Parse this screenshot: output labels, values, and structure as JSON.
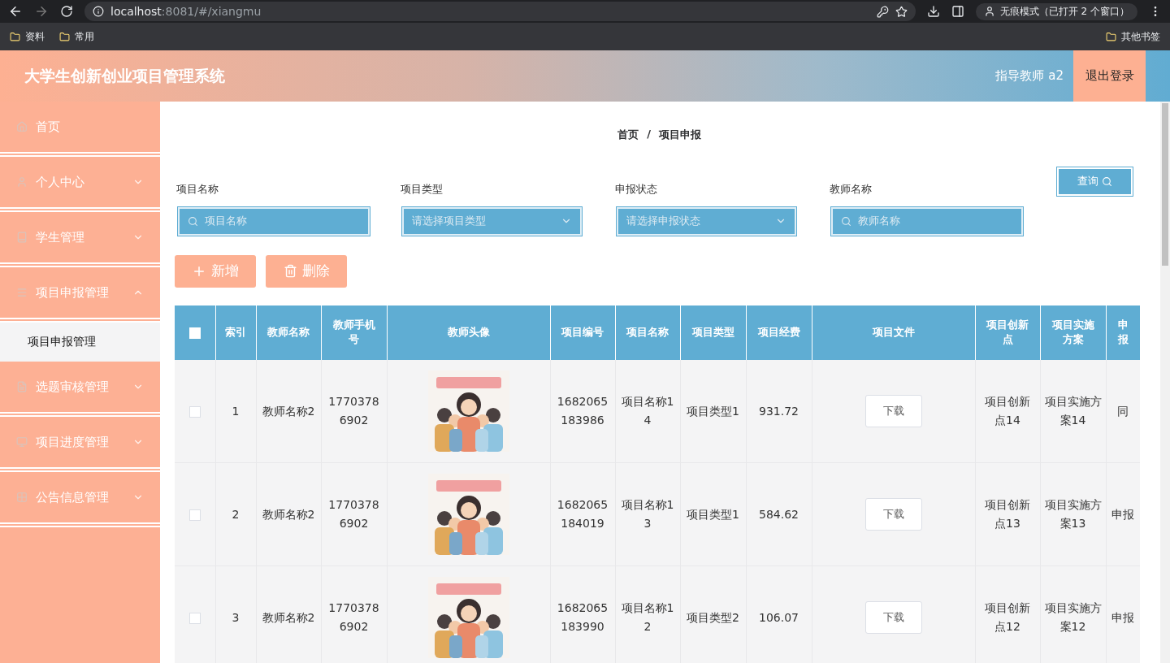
{
  "browser": {
    "url_host": "localhost",
    "url_rest": ":8081/#/xiangmu",
    "incognito": "无痕模式（已打开 2 个窗口）",
    "bookmarks": [
      "资料",
      "常用"
    ],
    "other_bookmarks": "其他书签"
  },
  "header": {
    "title": "大学生创新创业项目管理系统",
    "user": "指导教师 a2",
    "logout": "退出登录"
  },
  "sidebar": {
    "items": [
      {
        "label": "首页",
        "selected": false
      },
      {
        "label": "个人中心",
        "expanded": false,
        "selected": false
      },
      {
        "label": "学生管理",
        "expanded": false,
        "selected": false
      },
      {
        "label": "项目申报管理",
        "expanded": true,
        "selected": false,
        "children": [
          {
            "label": "项目申报管理",
            "selected": true
          }
        ]
      },
      {
        "label": "选题审核管理",
        "expanded": false,
        "selected": false
      },
      {
        "label": "项目进度管理",
        "expanded": false,
        "selected": false
      },
      {
        "label": "公告信息管理",
        "expanded": false,
        "selected": false
      }
    ]
  },
  "breadcrumb": {
    "items": [
      "首页",
      "项目申报"
    ],
    "separator": "/"
  },
  "filters": [
    {
      "label": "项目名称",
      "placeholder": "项目名称",
      "kind": "search"
    },
    {
      "label": "项目类型",
      "placeholder": "请选择项目类型",
      "kind": "select"
    },
    {
      "label": "申报状态",
      "placeholder": "请选择申报状态",
      "kind": "select"
    },
    {
      "label": "教师名称",
      "placeholder": "教师名称",
      "kind": "search"
    }
  ],
  "search_button": "查询",
  "actions": [
    {
      "label": "新增",
      "kind": "add"
    },
    {
      "label": "删除",
      "kind": "delete"
    }
  ],
  "table": {
    "select_all": {
      "checked": false
    },
    "columns": [
      "索引",
      "教师名称",
      "教师手机号",
      "教师头像",
      "项目编号",
      "项目名称",
      "项目类型",
      "项目经费",
      "项目文件",
      "项目创新点",
      "项目实施方案",
      "申报"
    ],
    "rows": [
      {
        "checked": false,
        "index": "1",
        "teacher": "教师名称2",
        "phone": "17703786902",
        "number": "1682065183986",
        "name": "项目名称14",
        "type": "项目类型1",
        "funding": "931.72",
        "file": "下载",
        "innovation": "项目创新点14",
        "plan": "项目实施方案14",
        "status": "同"
      },
      {
        "checked": false,
        "index": "2",
        "teacher": "教师名称2",
        "phone": "17703786902",
        "number": "1682065184019",
        "name": "项目名称13",
        "type": "项目类型1",
        "funding": "584.62",
        "file": "下载",
        "innovation": "项目创新点13",
        "plan": "项目实施方案13",
        "status": "申报"
      },
      {
        "checked": false,
        "index": "3",
        "teacher": "教师名称2",
        "phone": "17703786902",
        "number": "1682065183990",
        "name": "项目名称12",
        "type": "项目类型2",
        "funding": "106.07",
        "file": "下载",
        "innovation": "项目创新点12",
        "plan": "项目实施方案12",
        "status": "申报"
      }
    ]
  }
}
